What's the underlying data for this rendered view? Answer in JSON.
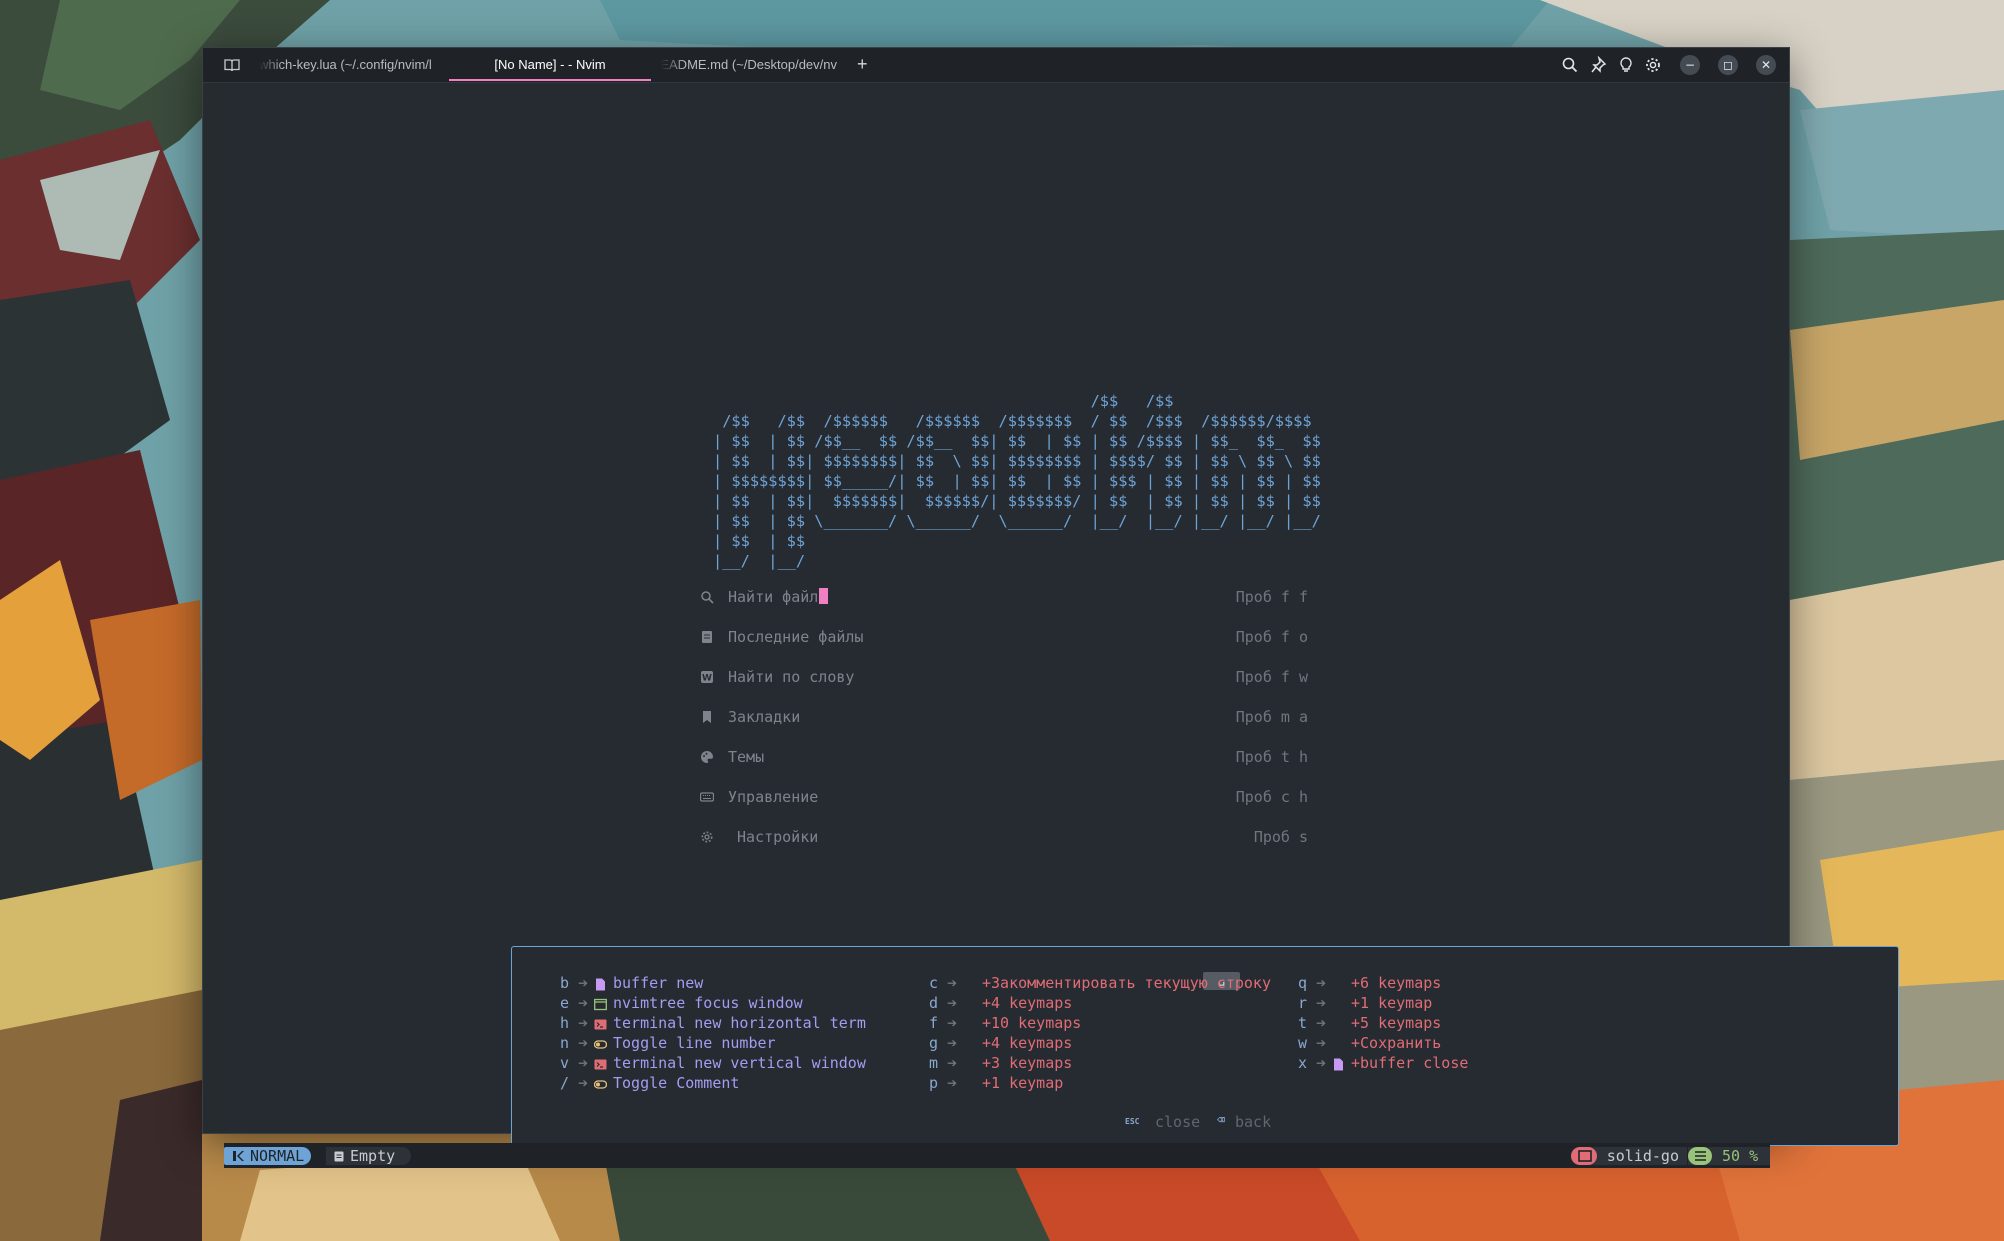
{
  "window": {
    "tabs": [
      {
        "label": "which-key.lua (~/.config/nvim/l"
      },
      {
        "label": "[No Name] - - Nvim"
      },
      {
        "label": "README.md (~/Desktop/dev/nv"
      }
    ],
    "new_tab_label": "+",
    "titlebar_icons": [
      "book-icon",
      "search-icon",
      "pin-icon",
      "bulb-icon",
      "gear-icon"
    ],
    "controls": {
      "minimize": "−",
      "maximize": "◻",
      "close": "✕"
    }
  },
  "dashboard": {
    "ascii_header": "                                         /$$   /$$\n /$$   /$$  /$$$$$$   /$$$$$$  /$$$$$$$  / $$  /$$$  /$$$$$$/$$$$\n| $$  | $$ /$$__  $$ /$$__  $$| $$  | $$ | $$ /$$$$ | $$_  $$_  $$\n| $$  | $$| $$$$$$$$| $$  \\ $$| $$$$$$$$ | $$$$/ $$ | $$ \\ $$ \\ $$\n| $$$$$$$$| $$_____/| $$  | $$| $$  | $$ | $$$ | $$ | $$ | $$ | $$\n| $$  | $$|  $$$$$$$|  $$$$$$/| $$$$$$$/ | $$  | $$ | $$ | $$ | $$\n| $$  | $$ \\_______/ \\______/  \\______/  |__/  |__/ |__/ |__/ |__/\n| $$  | $$\n|__/  |__/",
    "items": [
      {
        "icon": "search-icon",
        "label": "Найти файл",
        "shortcut": "Проб f f"
      },
      {
        "icon": "file-list-icon",
        "label": "Последние файлы",
        "shortcut": "Проб f o"
      },
      {
        "icon": "word-icon",
        "label": "Найти по слову",
        "shortcut": "Проб f w"
      },
      {
        "icon": "bookmark-icon",
        "label": "Закладки",
        "shortcut": "Проб m a"
      },
      {
        "icon": "palette-icon",
        "label": "Темы",
        "shortcut": "Проб t h"
      },
      {
        "icon": "keyboard-icon",
        "label": "Управление",
        "shortcut": "Проб c h"
      },
      {
        "icon": "gear-icon",
        "label": "Настройки",
        "shortcut": "Проб s"
      }
    ]
  },
  "whichkey": {
    "tab_label": "␣",
    "col1": [
      {
        "key": "b",
        "icon": "file-icon",
        "desc": "buffer new"
      },
      {
        "key": "e",
        "icon": "window-icon",
        "desc": "nvimtree focus window"
      },
      {
        "key": "h",
        "icon": "terminal-icon",
        "desc": "terminal new horizontal term"
      },
      {
        "key": "n",
        "icon": "toggle-icon",
        "desc": "Toggle line number"
      },
      {
        "key": "v",
        "icon": "terminal-icon",
        "desc": "terminal new vertical window"
      },
      {
        "key": "/",
        "icon": "toggle-icon",
        "desc": "Toggle Comment"
      }
    ],
    "col2": [
      {
        "key": "c",
        "desc": "+Закомментировать текущую строку"
      },
      {
        "key": "d",
        "desc": "+4 keymaps"
      },
      {
        "key": "f",
        "desc": "+10 keymaps"
      },
      {
        "key": "g",
        "desc": "+4 keymaps"
      },
      {
        "key": "m",
        "desc": "+3 keymaps"
      },
      {
        "key": "p",
        "desc": "+1 keymap"
      }
    ],
    "col3": [
      {
        "key": "q",
        "desc": "+6 keymaps"
      },
      {
        "key": "r",
        "desc": "+1 keymap"
      },
      {
        "key": "t",
        "desc": "+5 keymaps"
      },
      {
        "key": "w",
        "desc": "+Сохранить"
      },
      {
        "key": "x",
        "icon": "file-icon",
        "desc": "+buffer close"
      }
    ],
    "footer": {
      "esc_key": "ESC",
      "close": "close",
      "back_key": "⌫",
      "back": "back"
    }
  },
  "statusline": {
    "mode": "NORMAL",
    "file": "Empty",
    "cwd": "solid-go",
    "percent": "50 %"
  },
  "colors": {
    "accent": "#6ea3d6",
    "tab_underline": "#f07fc4",
    "group_red": "#e06c75",
    "desc_purple": "#a59bf0",
    "percent_green": "#98c379"
  }
}
